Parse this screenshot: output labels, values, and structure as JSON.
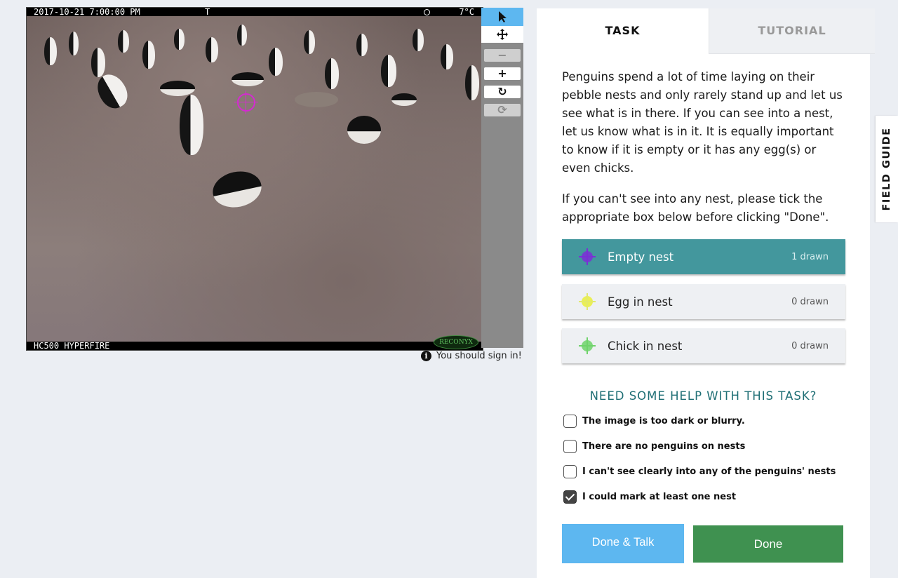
{
  "camera": {
    "timestamp": "2017-10-21 7:00:00 PM",
    "mode": "T",
    "temperature": "7°C",
    "model": "HC500 HYPERFIRE",
    "brand": "RECONYX"
  },
  "toolbar": {
    "select_icon": "pointer-arrow-icon",
    "pan_icon": "move-arrows-icon",
    "zoom_out": "−",
    "zoom_in": "+",
    "rotate": "↻",
    "reset": "⟳"
  },
  "signin_notice": "You should sign in!",
  "tabs": {
    "task": "TASK",
    "tutorial": "TUTORIAL"
  },
  "instructions": {
    "p1": "Penguins spend a lot of time laying on their pebble nests and only rarely stand up and let us see what is in there. If you can see into a nest, let us know what is in it. It is equally important to know if it is empty or it has any egg(s) or even chicks.",
    "p2": "If you can't see into any nest, please tick the appropriate box below before clicking \"Done\"."
  },
  "tools": [
    {
      "label": "Empty nest",
      "count": "1 drawn",
      "color": "#7b2fd6",
      "selected": true
    },
    {
      "label": "Egg in nest",
      "count": "0 drawn",
      "color": "#e9ef3a",
      "selected": false
    },
    {
      "label": "Chick in nest",
      "count": "0 drawn",
      "color": "#6fd36a",
      "selected": false
    }
  ],
  "help_heading": "NEED SOME HELP WITH THIS TASK?",
  "checkboxes": [
    {
      "label": "The image is too dark or blurry.",
      "checked": false
    },
    {
      "label": "There are no penguins on nests",
      "checked": false
    },
    {
      "label": "I can't see clearly into any of the penguins' nests",
      "checked": false
    },
    {
      "label": "I could mark at least one nest",
      "checked": true
    }
  ],
  "buttons": {
    "done_talk": "Done & Talk",
    "done": "Done"
  },
  "field_guide": "FIELD GUIDE",
  "colors": {
    "accent": "#43979d",
    "talk_button": "#5db7f0",
    "done_button": "#3f9150",
    "marker": "#d42bd0"
  }
}
